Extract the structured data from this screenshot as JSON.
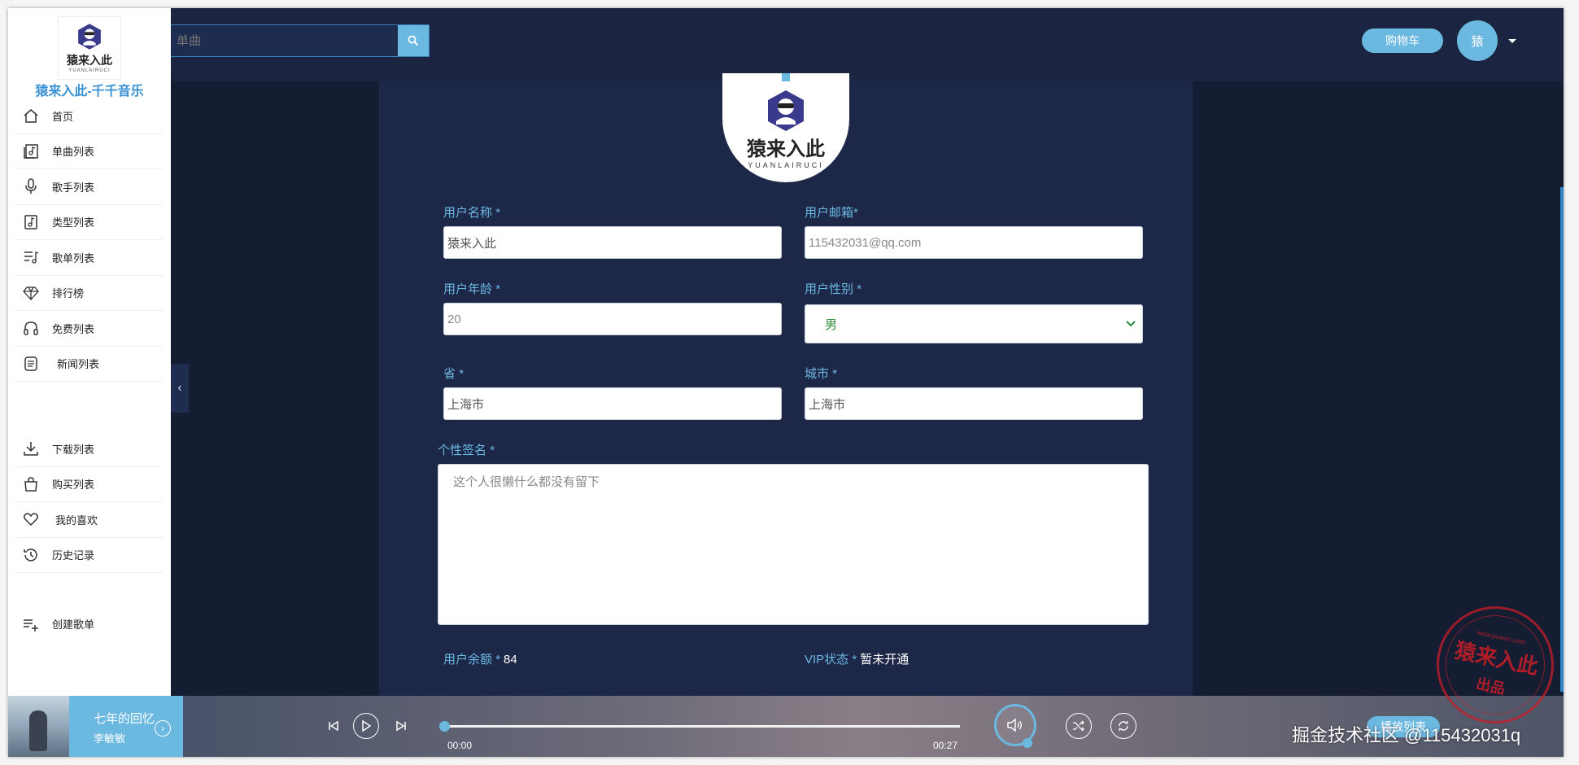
{
  "header": {
    "search_placeholder": "单曲",
    "cart_label": "购物车",
    "avatar_label": "猿"
  },
  "sidebar": {
    "logo_text": "猿来入此",
    "logo_subtext": "YUANLAIRUCI",
    "brand": "猿来入此-千千音乐",
    "items": [
      {
        "label": "首页",
        "icon": "home-icon"
      },
      {
        "label": "单曲列表",
        "icon": "music-list-icon"
      },
      {
        "label": "歌手列表",
        "icon": "microphone-icon"
      },
      {
        "label": "类型列表",
        "icon": "music-note-icon"
      },
      {
        "label": "歌单列表",
        "icon": "playlist-icon"
      },
      {
        "label": "排行榜",
        "icon": "diamond-icon"
      },
      {
        "label": "免费列表",
        "icon": "headphones-icon"
      },
      {
        "label": "新闻列表",
        "icon": "news-icon"
      }
    ],
    "items2": [
      {
        "label": "下载列表",
        "icon": "download-icon"
      },
      {
        "label": "购买列表",
        "icon": "shopping-bag-icon"
      },
      {
        "label": "我的喜欢",
        "icon": "heart-icon"
      },
      {
        "label": "历史记录",
        "icon": "history-icon"
      }
    ],
    "create_playlist": "创建歌单"
  },
  "profile": {
    "logo_text": "猿来入此",
    "logo_subtext": "YUANLAIRUCI",
    "username_label": "用户名称",
    "username_value": "猿来入此",
    "email_label": "用户邮箱",
    "email_placeholder": "115432031@qq.com",
    "age_label": "用户年龄",
    "age_placeholder": "20",
    "gender_label": "用户性别",
    "gender_value": "男",
    "province_label": "省",
    "province_value": "上海市",
    "city_label": "城市",
    "city_value": "上海市",
    "signature_label": "个性签名",
    "signature_placeholder": "这个人很懒什么都没有留下",
    "balance_label": "用户余额",
    "balance_value": "84",
    "vip_label": "VIP状态",
    "vip_value": "暂未开通",
    "required_mark": "*"
  },
  "player": {
    "song_title": "七年的回忆",
    "artist": "李敏敏",
    "current_time": "00:00",
    "total_time": "00:27",
    "progress": 0,
    "playlist_label": "播放列表"
  },
  "overlay": {
    "watermark": "掘金技术社区 @115432031q",
    "stamp_line1": "猿来入此",
    "stamp_line2": "出品",
    "stamp_url": "www.yuanrc.com"
  },
  "colors": {
    "accent": "#6bb8e0",
    "background": "#1b2440",
    "panel": "#1d2748",
    "label": "#6bb8e0"
  }
}
